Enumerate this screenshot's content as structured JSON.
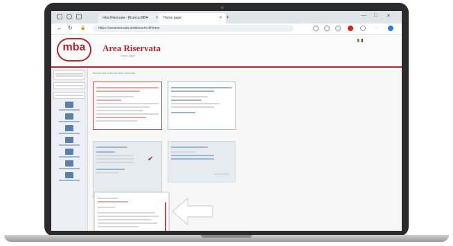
{
  "browser": {
    "tabs": [
      {
        "label": "mba Riservata - Ricerca MBA"
      },
      {
        "label": "Home page"
      }
    ],
    "url": "https://areariservata.ambituscrh.it/Home",
    "new_tab": "+"
  },
  "header": {
    "logo": "mba",
    "title": "Area Riservata",
    "subtitle": "Home page"
  },
  "main": {
    "welcome": "Benvenuto nella tua area riservata"
  },
  "colors": {
    "brand": "#b3262b",
    "accent": "#5b7fa6"
  }
}
